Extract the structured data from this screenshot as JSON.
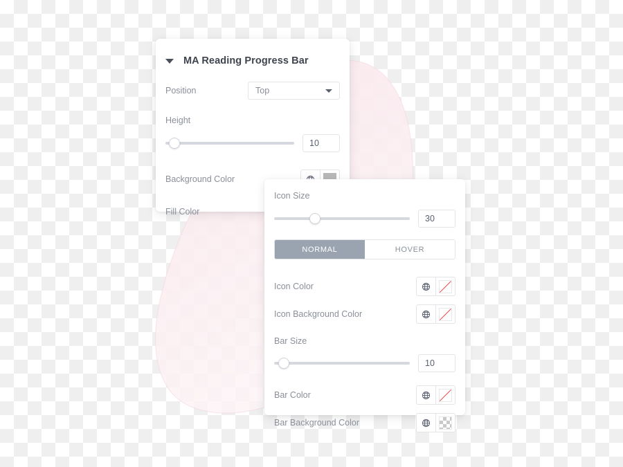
{
  "background": {
    "checker_light": "#ffffff",
    "checker_dark": "#efefef",
    "blob_color": "#f7dde4"
  },
  "panel_reading_progress": {
    "title": "MA Reading Progress Bar",
    "caret_icon": "caret-down-icon",
    "position": {
      "label": "Position",
      "value": "Top",
      "caret_icon": "chevron-down-icon"
    },
    "height": {
      "label": "Height",
      "value": "10",
      "handle_pct": 7
    },
    "background_color": {
      "label": "Background Color",
      "globe_icon": "globe-icon",
      "swatch_type": "solid",
      "swatch_color": "#b8b8b8"
    },
    "fill_color": {
      "label": "Fill Color"
    }
  },
  "panel_icon_settings": {
    "icon_size": {
      "label": "Icon Size",
      "value": "30",
      "handle_pct": 30
    },
    "state_tabs": {
      "normal": "NORMAL",
      "hover": "HOVER",
      "active": "NORMAL"
    },
    "icon_color": {
      "label": "Icon Color",
      "globe_icon": "globe-icon",
      "swatch_type": "empty"
    },
    "icon_background_color": {
      "label": "Icon Background Color",
      "globe_icon": "globe-icon",
      "swatch_type": "empty"
    },
    "bar_size": {
      "label": "Bar Size",
      "value": "10",
      "handle_pct": 7
    },
    "bar_color": {
      "label": "Bar Color",
      "globe_icon": "globe-icon",
      "swatch_type": "empty"
    },
    "bar_background_color": {
      "label": "Bar Background Color",
      "globe_icon": "globe-icon",
      "swatch_type": "checker"
    }
  }
}
